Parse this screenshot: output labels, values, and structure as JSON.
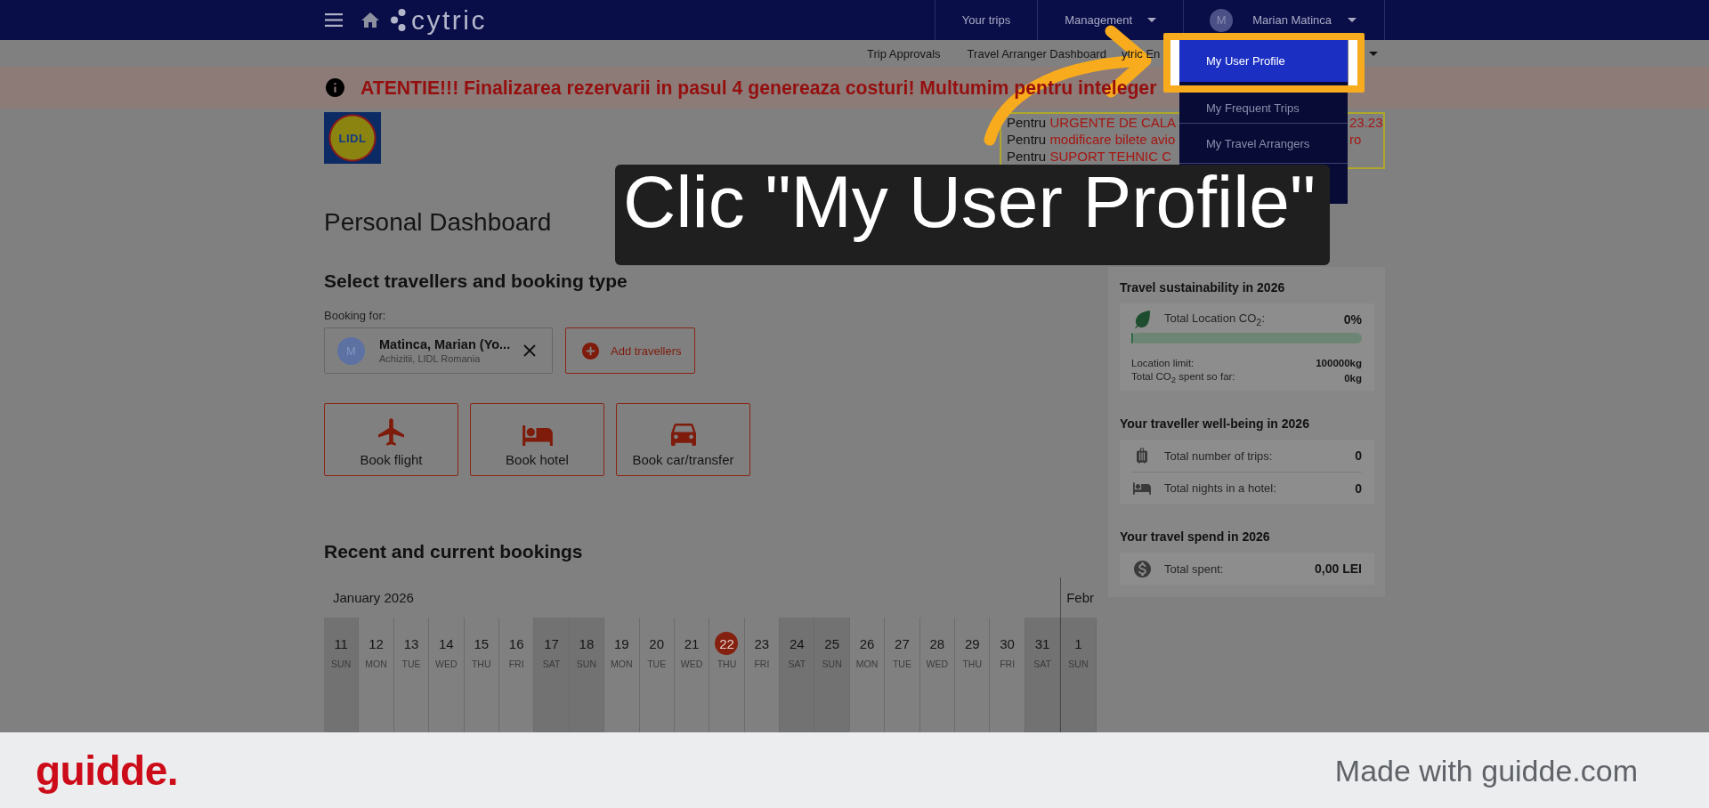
{
  "top_nav": {
    "logo_text": "cytric",
    "links": [
      {
        "label": "Your trips",
        "dropdown": false
      },
      {
        "label": "Management",
        "dropdown": true
      }
    ],
    "user": {
      "initial": "M",
      "name": "Marian Matinca"
    }
  },
  "sub_nav": {
    "links": [
      "Trip Approvals",
      "Travel Arranger Dashboard",
      "ytric En"
    ]
  },
  "alert": {
    "text": "ATENTIE!!! Finalizarea rezervarii in pasul 4 genereaza costuri! Multumim pentru inteleger"
  },
  "company_logo": {
    "text": "LIDL"
  },
  "contact_box": {
    "lines": [
      {
        "prefix": "Pentru",
        "highlight": "URGENTE DE CALA",
        "tail": "23.23"
      },
      {
        "prefix": "Pentru",
        "highlight": "modificare bilete avio",
        "tail": "ro"
      },
      {
        "prefix": "Pentru",
        "highlight": "SUPORT TEHNIC C"
      }
    ]
  },
  "user_menu": {
    "items": [
      {
        "label": "My User Profile",
        "selected": true
      },
      {
        "label": "My Frequent Trips",
        "selected": false
      },
      {
        "label": "My Travel Arrangers",
        "selected": false
      }
    ]
  },
  "page_title": "Personal Dashboard",
  "booking": {
    "title": "Select travellers and booking type",
    "booking_for_label": "Booking for:",
    "traveller": {
      "initial": "M",
      "name": "Matinca, Marian (Yo...",
      "org": "Achizitii, LIDL Romania"
    },
    "add_button": "Add travellers",
    "types": [
      {
        "kind": "flight",
        "label": "Book flight"
      },
      {
        "kind": "hotel",
        "label": "Book hotel"
      },
      {
        "kind": "car",
        "label": "Book car/transfer"
      }
    ]
  },
  "bookings": {
    "title": "Recent and current bookings",
    "months": [
      {
        "label": "January 2026",
        "days": [
          {
            "day": "11",
            "weekday": "SUN",
            "weekend": true,
            "today": false
          },
          {
            "day": "12",
            "weekday": "MON",
            "weekend": false,
            "today": false
          },
          {
            "day": "13",
            "weekday": "TUE",
            "weekend": false,
            "today": false
          },
          {
            "day": "14",
            "weekday": "WED",
            "weekend": false,
            "today": false
          },
          {
            "day": "15",
            "weekday": "THU",
            "weekend": false,
            "today": false
          },
          {
            "day": "16",
            "weekday": "FRI",
            "weekend": false,
            "today": false
          },
          {
            "day": "17",
            "weekday": "SAT",
            "weekend": true,
            "today": false
          },
          {
            "day": "18",
            "weekday": "SUN",
            "weekend": true,
            "today": false
          },
          {
            "day": "19",
            "weekday": "MON",
            "weekend": false,
            "today": false
          },
          {
            "day": "20",
            "weekday": "TUE",
            "weekend": false,
            "today": false
          },
          {
            "day": "21",
            "weekday": "WED",
            "weekend": false,
            "today": false
          },
          {
            "day": "22",
            "weekday": "THU",
            "weekend": false,
            "today": true
          },
          {
            "day": "23",
            "weekday": "FRI",
            "weekend": false,
            "today": false
          },
          {
            "day": "24",
            "weekday": "SAT",
            "weekend": true,
            "today": false
          },
          {
            "day": "25",
            "weekday": "SUN",
            "weekend": true,
            "today": false
          },
          {
            "day": "26",
            "weekday": "MON",
            "weekend": false,
            "today": false
          },
          {
            "day": "27",
            "weekday": "TUE",
            "weekend": false,
            "today": false
          },
          {
            "day": "28",
            "weekday": "WED",
            "weekend": false,
            "today": false
          },
          {
            "day": "29",
            "weekday": "THU",
            "weekend": false,
            "today": false
          },
          {
            "day": "30",
            "weekday": "FRI",
            "weekend": false,
            "today": false
          },
          {
            "day": "31",
            "weekday": "SAT",
            "weekend": true,
            "today": false
          }
        ]
      },
      {
        "label": "Febr",
        "days": [
          {
            "day": "1",
            "weekday": "SUN",
            "weekend": true,
            "today": false
          }
        ]
      }
    ]
  },
  "sidebar": {
    "sections": [
      {
        "kind": "sustainability",
        "title": "Travel sustainability in 2026",
        "metric": {
          "label": "Total Location CO$_{2}$:",
          "value": "0%",
          "level": 0
        },
        "details": [
          {
            "label": "Location limit:",
            "value": "100000kg"
          },
          {
            "label": "Total CO$_{2}$ spent so far:",
            "value": "0kg"
          }
        ]
      },
      {
        "kind": "stats",
        "title": "Your traveller well-being in 2026",
        "rows": [
          {
            "kind": "trips",
            "label": "Total number of trips:",
            "value": "0"
          },
          {
            "kind": "nights",
            "label": "Total nights in a hotel:",
            "value": "0"
          }
        ]
      },
      {
        "kind": "stats",
        "title": "Your travel spend in 2026",
        "rows": [
          {
            "kind": "spend",
            "label": "Total spent:",
            "value": "0,00 LEI"
          }
        ]
      }
    ]
  },
  "tooltip": {
    "text": "Clic \"My User Profile\""
  },
  "footer": {
    "logo_text": "guidde.",
    "credit": "Made with guidde.com"
  }
}
